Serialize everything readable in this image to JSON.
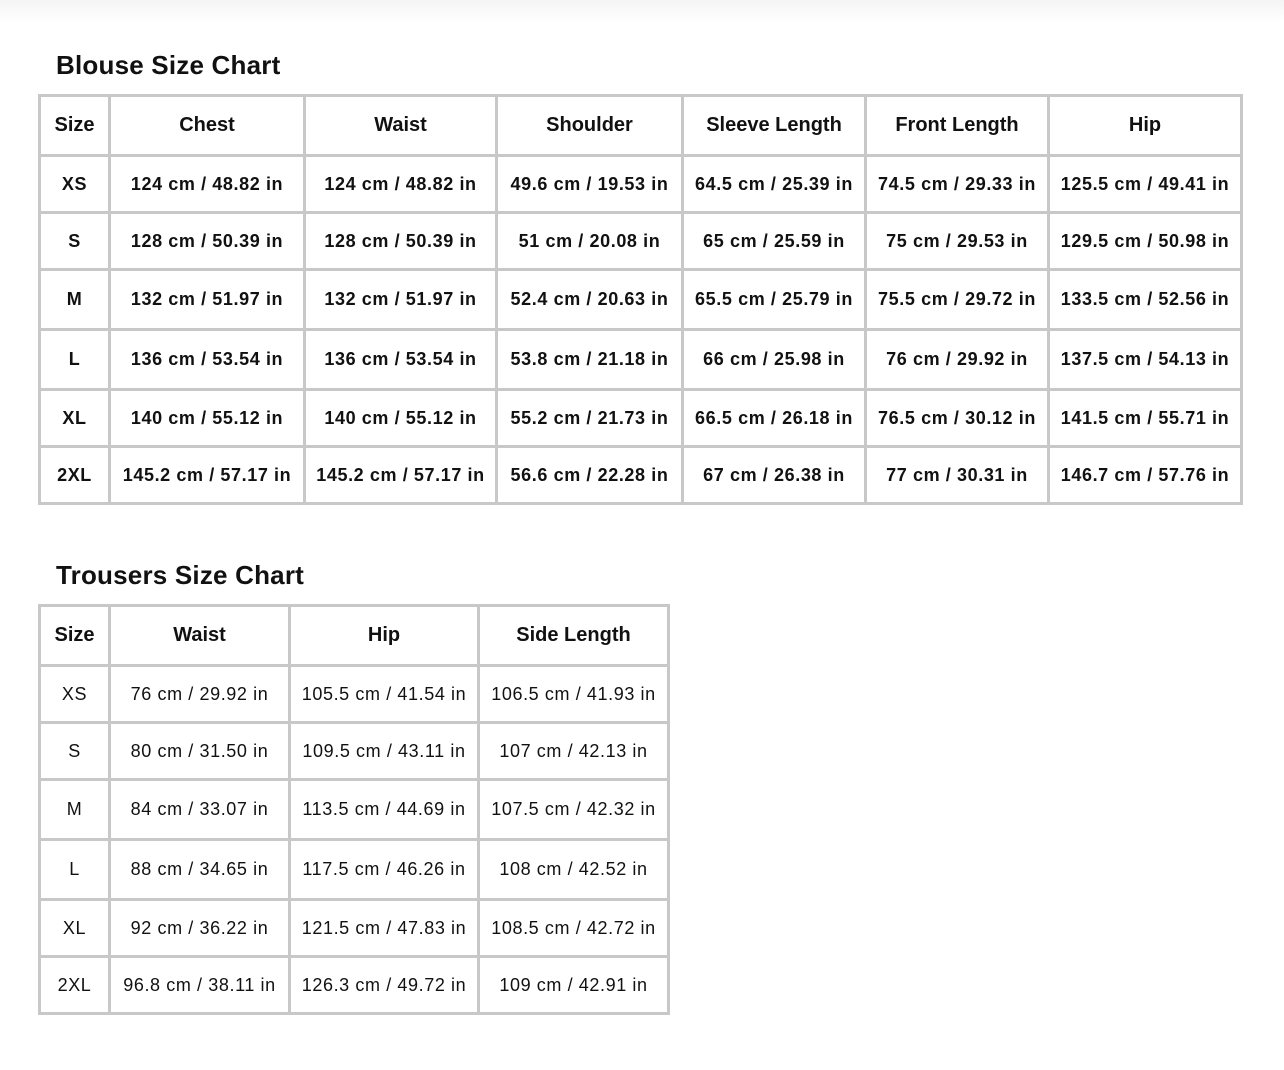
{
  "blouse": {
    "title": "Blouse Size Chart",
    "headers": [
      "Size",
      "Chest",
      "Waist",
      "Shoulder",
      "Sleeve Length",
      "Front Length",
      "Hip"
    ],
    "rows": [
      [
        "XS",
        "124 cm / 48.82 in",
        "124 cm / 48.82 in",
        "49.6 cm / 19.53 in",
        "64.5 cm / 25.39 in",
        "74.5 cm / 29.33 in",
        "125.5 cm / 49.41 in"
      ],
      [
        "S",
        "128 cm / 50.39 in",
        "128 cm / 50.39 in",
        "51 cm / 20.08 in",
        "65 cm / 25.59 in",
        "75 cm / 29.53 in",
        "129.5 cm / 50.98 in"
      ],
      [
        "M",
        "132 cm / 51.97 in",
        "132 cm / 51.97 in",
        "52.4 cm / 20.63 in",
        "65.5 cm / 25.79 in",
        "75.5 cm / 29.72 in",
        "133.5 cm / 52.56 in"
      ],
      [
        "L",
        "136 cm / 53.54 in",
        "136 cm / 53.54 in",
        "53.8 cm / 21.18 in",
        "66 cm / 25.98 in",
        "76 cm / 29.92 in",
        "137.5 cm / 54.13 in"
      ],
      [
        "XL",
        "140 cm / 55.12 in",
        "140 cm / 55.12 in",
        "55.2 cm / 21.73 in",
        "66.5 cm / 26.18 in",
        "76.5 cm / 30.12 in",
        "141.5 cm / 55.71 in"
      ],
      [
        "2XL",
        "145.2 cm / 57.17 in",
        "145.2 cm / 57.17 in",
        "56.6 cm / 22.28 in",
        "67 cm / 26.38 in",
        "77 cm / 30.31 in",
        "146.7 cm / 57.76 in"
      ]
    ]
  },
  "trousers": {
    "title": "Trousers Size Chart",
    "headers": [
      "Size",
      "Waist",
      "Hip",
      "Side Length"
    ],
    "rows": [
      [
        "XS",
        "76 cm / 29.92 in",
        "105.5 cm / 41.54 in",
        "106.5 cm / 41.93 in"
      ],
      [
        "S",
        "80 cm / 31.50 in",
        "109.5 cm / 43.11 in",
        "107 cm / 42.13 in"
      ],
      [
        "M",
        "84 cm / 33.07 in",
        "113.5 cm / 44.69 in",
        "107.5 cm / 42.32 in"
      ],
      [
        "L",
        "88 cm / 34.65 in",
        "117.5 cm / 46.26 in",
        "108 cm / 42.52 in"
      ],
      [
        "XL",
        "92 cm / 36.22 in",
        "121.5 cm / 47.83 in",
        "108.5 cm / 42.72 in"
      ],
      [
        "2XL",
        "96.8 cm / 38.11 in",
        "126.3 cm / 49.72 in",
        "109 cm / 42.91 in"
      ]
    ]
  },
  "colors": {
    "border": "#c8c8c8",
    "text": "#111111",
    "background": "#ffffff"
  }
}
